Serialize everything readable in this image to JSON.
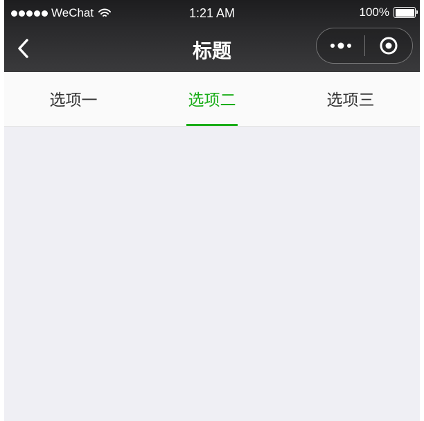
{
  "status_bar": {
    "carrier": "WeChat",
    "time": "1:21 AM",
    "battery": "100%",
    "signal_icon": "signal-dots-icon",
    "wifi_icon": "wifi-icon",
    "battery_icon": "battery-icon"
  },
  "nav_bar": {
    "title": "标题",
    "back_icon": "chevron-left-icon",
    "more_icon": "more-dots-icon",
    "close_icon": "target-circle-icon"
  },
  "tabs": [
    {
      "label": "选项一",
      "active": false
    },
    {
      "label": "选项二",
      "active": true
    },
    {
      "label": "选项三",
      "active": false
    }
  ],
  "colors": {
    "accent": "#1aad19",
    "nav_bg": "#2a2a2c",
    "page_bg": "#efeff4",
    "tab_bg": "#fafafa"
  }
}
